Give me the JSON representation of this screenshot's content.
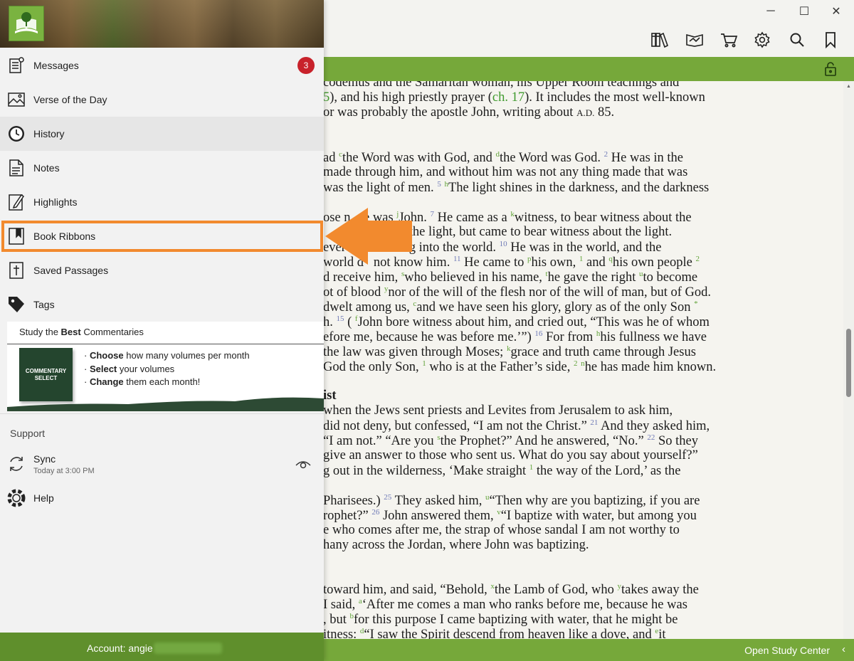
{
  "window": {
    "minimize_glyph": "─",
    "maximize_glyph": "☐",
    "close_glyph": "✕"
  },
  "toolbar": {
    "icons": [
      "library-icon",
      "reading-plan-icon",
      "cart-icon",
      "settings-icon",
      "search-icon",
      "bookmark-icon"
    ]
  },
  "reader": {
    "lines": [
      {
        "cls": "",
        "html": "codemus and the Samaritan woman, his Upper Room teachings and"
      },
      {
        "cls": "",
        "html": "<span class='lnk'>5</span>), and his high priestly prayer (<span class='lnk'>ch. 17</span>). It includes the most well-known"
      },
      {
        "cls": "",
        "html": "or was probably the apostle John, writing about <span style='font-size:13px'>A.D.</span> 85."
      },
      {
        "cls": "",
        "html": "ad <span class='xr'>c</span>the Word was with God, and <span class='xr'>d</span>the Word was God. <span class='vn'>2</span> He was in the"
      },
      {
        "cls": "",
        "html": "made through him, and without him was not any thing made that was"
      },
      {
        "cls": "",
        "html": "was the light of men. <span class='vn'>5</span> <span class='xr'>h</span>The light shines in the darkness, and the darkness"
      },
      {
        "cls": "",
        "html": "ose n&nbsp;&nbsp;&nbsp;&nbsp;e was <span class='xr'>j</span>John. <span class='vn'>7</span> He came as a <span class='xr'>k</span>witness, to bear witness about the"
      },
      {
        "cls": "",
        "html": "&nbsp;&nbsp;&nbsp;&nbsp;&nbsp;&nbsp;&nbsp;&nbsp;&nbsp;&nbsp;&nbsp;&nbsp;&nbsp;&nbsp;&nbsp;&nbsp;&nbsp;&nbsp;&nbsp;&nbsp;&nbsp;&nbsp;&nbsp;&nbsp;t the light, but came to bear witness about the light."
      },
      {
        "cls": "",
        "html": "ever&nbsp;&nbsp;&nbsp;&nbsp;&nbsp;&nbsp;&nbsp;&nbsp;&nbsp;&nbsp;&nbsp;oming into the world. <span class='vn'>10</span> He was in the world, and the"
      },
      {
        "cls": "",
        "html": "world d&nbsp;&nbsp;&nbsp;not know him. <span class='vn'>11</span> He came to <span class='xr'>p</span>his own, <span class='xr'>1</span> and <span class='xr'>q</span>his own people <span class='xr'>2</span>"
      },
      {
        "cls": "",
        "html": "d receive him, <span class='xr'>s</span>who believed in his name, <span class='xr'>t</span>he gave the right <span class='xr'>u</span>to become"
      },
      {
        "cls": "",
        "html": "ot of blood <span class='xr'>y</span>nor of the will of the flesh nor of the will of man, but of God."
      },
      {
        "cls": "",
        "html": "dwelt among us, <span class='xr'>c</span>and we have seen his glory, glory as of the only Son <span class='xr'>*</span>"
      },
      {
        "cls": "",
        "html": "h. <span class='vn'>15</span> ( <span class='xr'>f</span>John bore witness about him, and cried out, “This was he of whom"
      },
      {
        "cls": "",
        "html": "efore me, because he was before me.’”) <span class='vn'>16</span> For from <span class='xr'>h</span>his fullness we have"
      },
      {
        "cls": "",
        "html": "the law was given through Moses; <span class='xr'>k</span>grace and truth came through Jesus"
      },
      {
        "cls": "",
        "html": "God the only Son, <span class='xr'>1</span> who is at the Father’s side, <span class='xr'>2</span> <span class='xr'>n</span>he has made him known."
      },
      {
        "cls": "heading",
        "html": "ist"
      },
      {
        "cls": "",
        "html": "when the Jews sent priests and Levites from Jerusalem to ask him,"
      },
      {
        "cls": "",
        "html": "did not deny, but confessed, “I am not the Christ.” <span class='vn'>21</span> And they asked him,"
      },
      {
        "cls": "",
        "html": "“I am not.” “Are you <span class='xr'>s</span>the Prophet?” And he answered, “No.” <span class='vn'>22</span> So they"
      },
      {
        "cls": "",
        "html": "give an answer to those who sent us. What do you say about yourself?”"
      },
      {
        "cls": "",
        "html": "g out in the wilderness, ‘Make straight <span class='xr'>1</span> the way of the Lord,’ as the"
      },
      {
        "cls": "",
        "html": "Pharisees.) <span class='vn'>25</span> They asked him, <span class='xr'>u</span>“Then why are you baptizing, if you are"
      },
      {
        "cls": "",
        "html": "rophet?” <span class='vn'>26</span> John answered them, <span class='xr'>v</span>“I baptize with water, but among you"
      },
      {
        "cls": "",
        "html": "e who comes after me, the strap of whose sandal I am not worthy to"
      },
      {
        "cls": "",
        "html": "hany across the Jordan, where John was baptizing."
      },
      {
        "cls": "",
        "html": "toward him, and said, “Behold, <span class='xr'>x</span>the Lamb of God, who <span class='xr'>y</span>takes away the"
      },
      {
        "cls": "",
        "html": "I said, <span class='xr'>a</span>‘After me comes a man who ranks before me, because he was"
      },
      {
        "cls": "",
        "html": ", but <span class='xr'>b</span>for this purpose I came baptizing with water, that he might be"
      },
      {
        "cls": "",
        "html": "itness: <span class='xr'>d</span>“I saw the Spirit descend from heaven like a dove, and <span class='xr'>e</span>it"
      }
    ]
  },
  "panel": {
    "menu": [
      {
        "label": "Messages",
        "icon": "messages-icon"
      },
      {
        "label": "Verse of the Day",
        "icon": "verse-of-day-icon"
      },
      {
        "label": "History",
        "icon": "history-icon"
      },
      {
        "label": "Notes",
        "icon": "notes-icon"
      },
      {
        "label": "Highlights",
        "icon": "highlights-icon"
      },
      {
        "label": "Book Ribbons",
        "icon": "book-ribbon-icon"
      },
      {
        "label": "Saved Passages",
        "icon": "saved-passages-icon"
      },
      {
        "label": "Tags",
        "icon": "tag-icon"
      }
    ],
    "messages_badge": "3",
    "promo": {
      "title_pre": "Study the ",
      "title_bold": "Best",
      "title_post": " Commentaries",
      "cover_text": "COMMENTARY SELECT",
      "lines": [
        {
          "bold": "Choose",
          "rest": " how many volumes per month"
        },
        {
          "bold": "Select",
          "rest": " your volumes"
        },
        {
          "bold": "Change",
          "rest": " them each month!"
        }
      ]
    },
    "support_title": "Support",
    "sync_label": "Sync",
    "sync_time": "Today at 3:00 PM",
    "help_label": "Help",
    "account_label": "Account: angie"
  },
  "footer": {
    "open_study_center": "Open Study Center",
    "chevron": "‹"
  },
  "colors": {
    "accent_green": "#76a83a",
    "dark_green": "#5f8f2c",
    "badge_red": "#c8222b",
    "highlight_orange": "#f28a2e"
  }
}
